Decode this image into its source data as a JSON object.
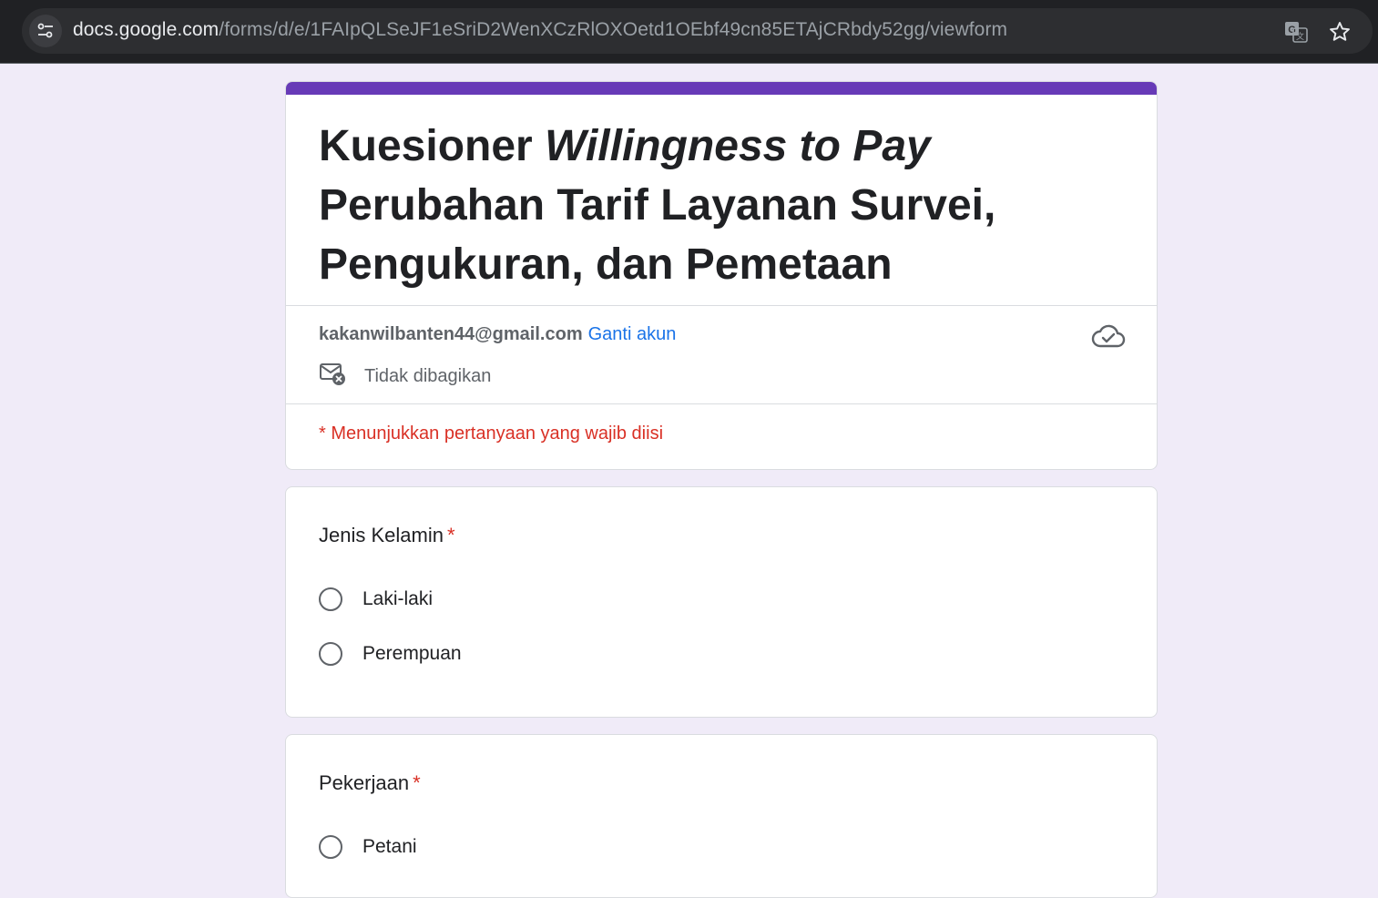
{
  "browser": {
    "url_host": "docs.google.com",
    "url_path": "/forms/d/e/1FAIpQLSeJF1eSriD2WenXCzRlOXOetd1OEbf49cn85ETAjCRbdy52gg/viewform",
    "icons": [
      "site-info-icon",
      "translate-icon",
      "bookmark-star-icon"
    ]
  },
  "form": {
    "accent_color": "#673ab7",
    "title_part1": "Kuesioner ",
    "title_italic": "Willingness to Pay",
    "title_part2": " Perubahan Tarif Layanan Survei, Pengukuran, dan Pemetaan",
    "account_email": "kakanwilbanten44@gmail.com",
    "switch_account": "Ganti akun",
    "not_shared": "Tidak dibagikan",
    "required_note": "* Menunjukkan pertanyaan yang wajib diisi"
  },
  "questions": [
    {
      "title": "Jenis Kelamin",
      "required_mark": "*",
      "options": [
        "Laki-laki",
        "Perempuan"
      ]
    },
    {
      "title": "Pekerjaan",
      "required_mark": "*",
      "options": [
        "Petani"
      ]
    }
  ]
}
